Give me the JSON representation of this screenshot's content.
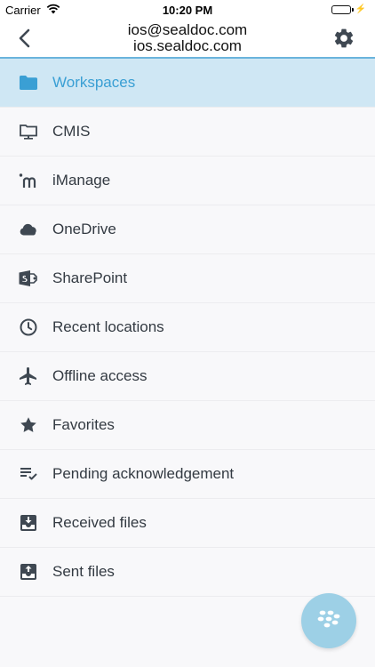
{
  "status_bar": {
    "carrier": "Carrier",
    "time": "10:20 PM"
  },
  "header": {
    "title_line1": "ios@sealdoc.com",
    "title_line2": "ios.sealdoc.com",
    "back_icon": "chevron-left-icon",
    "settings_icon": "gear-icon"
  },
  "colors": {
    "accent": "#3a9fd4",
    "selected_bg": "#cfe7f4",
    "icon": "#3f4852",
    "fab": "#9dd0e6"
  },
  "menu": {
    "items": [
      {
        "label": "Workspaces",
        "icon": "folder-icon",
        "selected": true
      },
      {
        "label": "CMIS",
        "icon": "monitor-folder-icon"
      },
      {
        "label": "iManage",
        "icon": "imanage-icon"
      },
      {
        "label": "OneDrive",
        "icon": "cloud-icon"
      },
      {
        "label": "SharePoint",
        "icon": "sharepoint-icon"
      },
      {
        "label": "Recent locations",
        "icon": "clock-icon"
      },
      {
        "label": "Offline access",
        "icon": "airplane-icon"
      },
      {
        "label": "Favorites",
        "icon": "star-icon"
      },
      {
        "label": "Pending acknowledgement",
        "icon": "checklist-icon"
      },
      {
        "label": "Received files",
        "icon": "inbox-download-icon"
      },
      {
        "label": "Sent files",
        "icon": "inbox-upload-icon"
      }
    ]
  },
  "fab": {
    "icon": "blackberry-icon"
  }
}
